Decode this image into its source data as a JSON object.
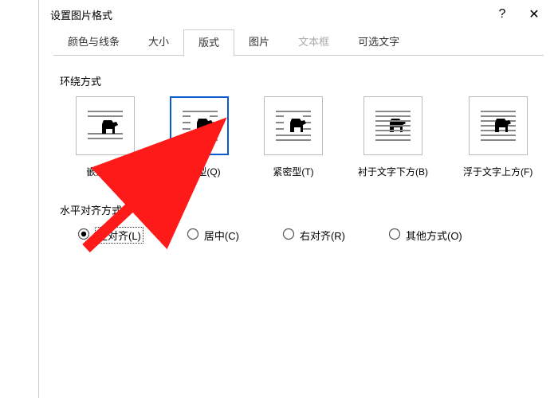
{
  "window": {
    "title": "设置图片格式",
    "help_icon": "?",
    "close_icon": "✕"
  },
  "tabs": [
    {
      "label": "颜色与线条",
      "active": false,
      "disabled": false
    },
    {
      "label": "大小",
      "active": false,
      "disabled": false
    },
    {
      "label": "版式",
      "active": true,
      "disabled": false
    },
    {
      "label": "图片",
      "active": false,
      "disabled": false
    },
    {
      "label": "文本框",
      "active": false,
      "disabled": true
    },
    {
      "label": "可选文字",
      "active": false,
      "disabled": false
    }
  ],
  "wrap_section": {
    "label": "环绕方式",
    "options": [
      {
        "id": "inline",
        "caption": "嵌入型(I)",
        "selected": false,
        "glyph": "inline"
      },
      {
        "id": "square",
        "caption": "四周型(Q)",
        "selected": true,
        "glyph": "square"
      },
      {
        "id": "tight",
        "caption": "紧密型(T)",
        "selected": false,
        "glyph": "tight"
      },
      {
        "id": "behind",
        "caption": "衬于文字下方(B)",
        "selected": false,
        "glyph": "behind"
      },
      {
        "id": "infront",
        "caption": "浮于文字上方(F)",
        "selected": false,
        "glyph": "infront"
      }
    ]
  },
  "align_section": {
    "label": "水平对齐方式",
    "options": [
      {
        "id": "left",
        "label": "左对齐(L)",
        "checked": true
      },
      {
        "id": "center",
        "label": "居中(C)",
        "checked": false
      },
      {
        "id": "right",
        "label": "右对齐(R)",
        "checked": false
      },
      {
        "id": "other",
        "label": "其他方式(O)",
        "checked": false
      }
    ]
  },
  "annotation": {
    "arrow_color": "#ff1a1a"
  }
}
